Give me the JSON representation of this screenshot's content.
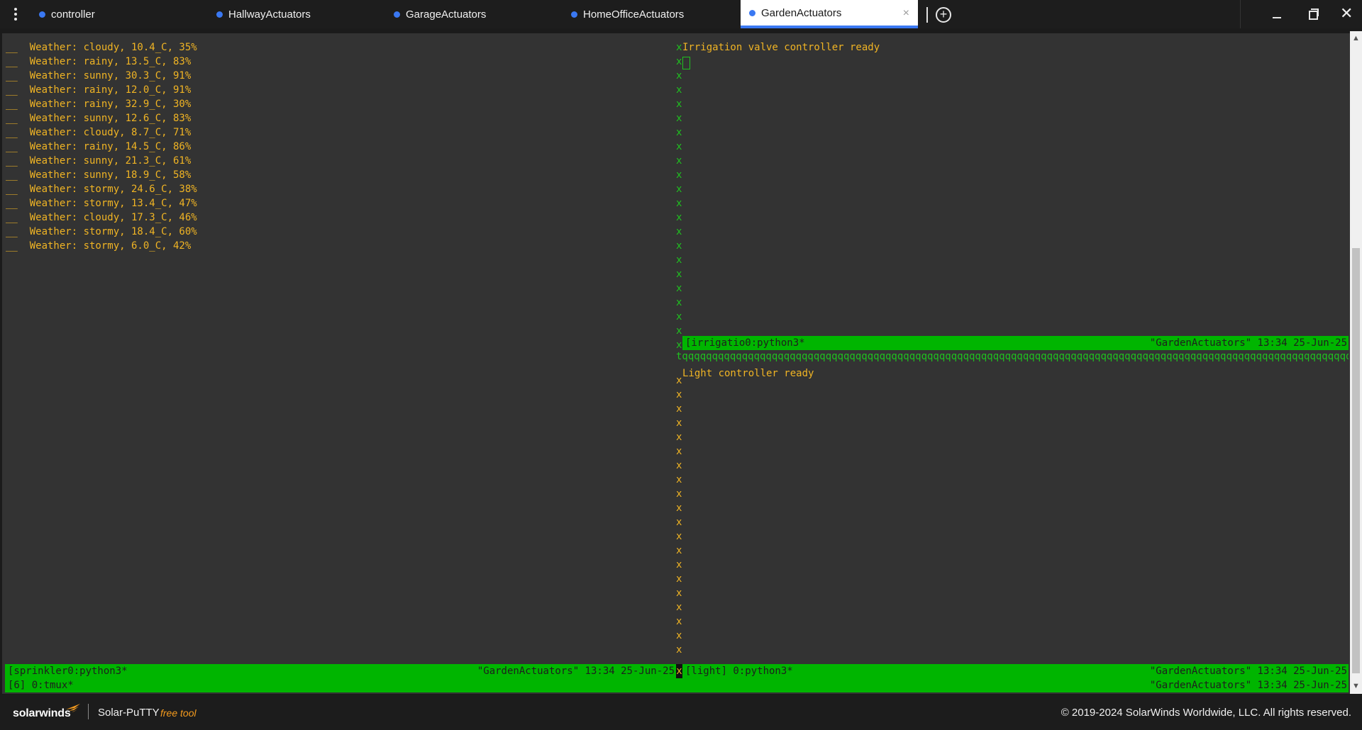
{
  "colors": {
    "tab_dot": "#3a78f2",
    "terminal_bg": "#333333",
    "text_orange": "#f0b424",
    "text_green": "#1fc11f",
    "status_bar": "#00b500",
    "brand_accent": "#f59b1e"
  },
  "tabs": [
    {
      "label": "controller"
    },
    {
      "label": "HallwayActuators"
    },
    {
      "label": "GarageActuators"
    },
    {
      "label": "HomeOfficeActuators"
    },
    {
      "label": "GardenActuators",
      "active": true,
      "close": "×"
    }
  ],
  "toolbar": {
    "new_tab_icon": "⊕",
    "menu_icon": "vertical-dots-icon",
    "minimize_icon": "minimize-icon",
    "restore_icon": "restore-icon",
    "close_icon": "✕"
  },
  "terminal": {
    "left_pane_lines": [
      "__  Weather: cloudy, 10.4_C, 35%",
      "__  Weather: rainy, 13.5_C, 83%",
      "__  Weather: sunny, 30.3_C, 91%",
      "__  Weather: rainy, 12.0_C, 91%",
      "__  Weather: rainy, 32.9_C, 30%",
      "__  Weather: sunny, 12.6_C, 83%",
      "__  Weather: cloudy, 8.7_C, 71%",
      "__  Weather: rainy, 14.5_C, 86%",
      "__  Weather: sunny, 21.3_C, 61%",
      "__  Weather: sunny, 18.9_C, 58%",
      "__  Weather: stormy, 24.6_C, 38%",
      "__  Weather: stormy, 13.4_C, 47%",
      "__  Weather: cloudy, 17.3_C, 46%",
      "__  Weather: stormy, 18.4_C, 60%",
      "__  Weather: stormy, 6.0_C, 42%"
    ],
    "border_char": "x",
    "divider_text": "tqqqqqqqqqqqqqqqqqqqqqqqqqqqqqqqqqqqqqqqqqqqqqqqqqqqqqqqqqqqqqqqqqqqqqqqqqqqqqqqqqqqqqqqqqqqqqqqqqqqqqqqqqqqqqqqqqqqqqqqqqqqqqqqqqqqqqqq",
    "irrigation_message": "Irrigation valve controller ready",
    "light_message": "Light controller ready",
    "status": {
      "irrigation_left": "[irrigatio0:python3*",
      "irrigation_right": "\"GardenActuators\" 13:34 25-Jun-25",
      "sprinkler_left": "[sprinkler0:python3*",
      "sprinkler_right": "\"GardenActuators\" 13:34 25-Jun-25",
      "light_left": "[light] 0:python3*",
      "light_right": "\"GardenActuators\" 13:34 25-Jun-25",
      "tmux_left": "[6] 0:tmux*",
      "tmux_right": "\"GardenActuators\" 13:34 25-Jun-25"
    }
  },
  "footer": {
    "brand": "solarwinds",
    "product": "Solar-PuTTY",
    "free_tool": "free tool",
    "copyright": "© 2019-2024 SolarWinds Worldwide, LLC. All rights reserved."
  }
}
